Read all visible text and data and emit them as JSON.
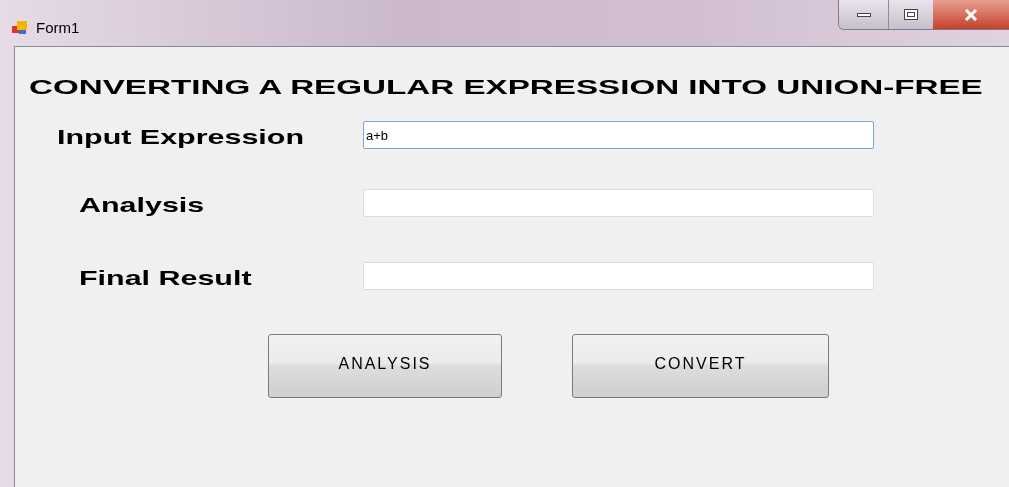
{
  "window": {
    "title": "Form1"
  },
  "heading": "CONVERTING A REGULAR EXPRESSION INTO UNION-FREE",
  "fields": [
    {
      "label": "Input Expression",
      "value": "a+b",
      "focused": true
    },
    {
      "label": "Analysis",
      "focused": false
    },
    {
      "label": "Final Result",
      "focused": false
    }
  ],
  "buttons": [
    "ANALYSIS",
    "CONVERT"
  ]
}
